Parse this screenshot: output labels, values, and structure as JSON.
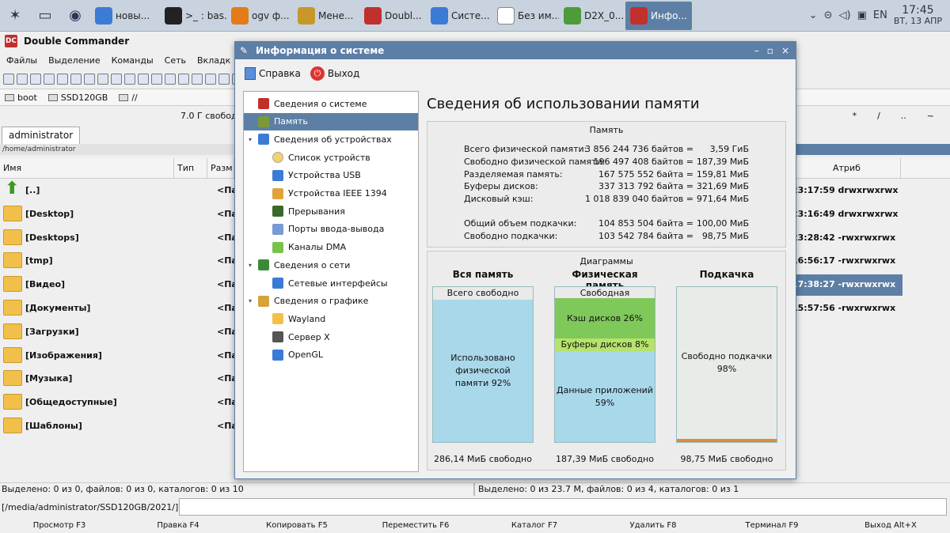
{
  "taskbar": {
    "tasks": [
      {
        "label": "новы...",
        "icon": "bird-icon",
        "color": "#3b7bd6"
      },
      {
        "label": ">_ : bas...",
        "icon": "terminal-icon",
        "color": "#222222"
      },
      {
        "label": "ogv ф...",
        "icon": "firefox-icon",
        "color": "#e37b19"
      },
      {
        "label": "Мене...",
        "icon": "package-icon",
        "color": "#c7972a"
      },
      {
        "label": "Doubl...",
        "icon": "dc-icon",
        "color": "#c0302c"
      },
      {
        "label": "Систе...",
        "icon": "monitor-icon",
        "color": "#3b7bd6"
      },
      {
        "label": "Без им...",
        "icon": "document-icon",
        "color": "#ffffff"
      },
      {
        "label": "D2X_0...",
        "icon": "image-icon",
        "color": "#4d9b3a"
      },
      {
        "label": "Инфо...",
        "icon": "star-icon",
        "color": "#c0302c"
      }
    ],
    "lang": "EN",
    "time": "17:45",
    "date": "ВТ, 13 АПР"
  },
  "dc": {
    "title": "Double Commander",
    "menu": [
      "Файлы",
      "Выделение",
      "Команды",
      "Сеть",
      "Вкладк"
    ],
    "drives": [
      "boot",
      "SSD120GB",
      "//"
    ],
    "free_left": "7.0 Г свобод",
    "right_sym": [
      "*",
      "/",
      "..",
      "~"
    ],
    "tab": "administrator",
    "path": "/home/administrator",
    "columns": {
      "name": "Имя",
      "type": "Тип",
      "size": "Разм",
      "attr": "Атриб"
    },
    "files": [
      {
        "name": "[..]",
        "size": "<Па",
        "date": "23:17:59 drwxrwxrwx",
        "up": true
      },
      {
        "name": "[Desktop]",
        "size": "<Па",
        "date": "23:16:49 drwxrwxrwx"
      },
      {
        "name": "[Desktops]",
        "size": "<Па",
        "date": "23:28:42 -rwxrwxrwx"
      },
      {
        "name": "[tmp]",
        "size": "<Па",
        "date": "16:56:17 -rwxrwxrwx"
      },
      {
        "name": "[Видео]",
        "size": "<Па",
        "date": "17:38:27 -rwxrwxrwx",
        "sel": true
      },
      {
        "name": "[Документы]",
        "size": "<Па",
        "date": "15:57:56 -rwxrwxrwx"
      },
      {
        "name": "[Загрузки]",
        "size": "<Па",
        "date": ""
      },
      {
        "name": "[Изображения]",
        "size": "<Па",
        "date": ""
      },
      {
        "name": "[Музыка]",
        "size": "<Па",
        "date": ""
      },
      {
        "name": "[Общедоступные]",
        "size": "<Па",
        "date": ""
      },
      {
        "name": "[Шаблоны]",
        "size": "<Па",
        "date": ""
      }
    ],
    "status_left": "Выделено: 0 из 0, файлов: 0 из 0, каталогов: 0 из 10",
    "status_right": "Выделено: 0 из 23.7 M, файлов: 0 из 4, каталогов: 0 из 1",
    "prompt": "[/media/administrator/SSD120GB/2021/]$:",
    "fkeys": [
      "Просмотр F3",
      "Правка F4",
      "Копировать F5",
      "Переместить F6",
      "Каталог F7",
      "Удалить F8",
      "Терминал F9",
      "Выход Alt+X"
    ]
  },
  "dialog": {
    "title": "Информация о системе",
    "help": "Справка",
    "exit": "Выход",
    "tree": [
      {
        "label": "Сведения о системе",
        "level": 0,
        "exp": "",
        "icon": "star-icon",
        "color": "#c0302c"
      },
      {
        "label": "Память",
        "level": 0,
        "exp": "",
        "icon": "memory-icon",
        "color": "#7a9a3a",
        "sel": true
      },
      {
        "label": "Сведения об устройствах",
        "level": 0,
        "exp": "▾",
        "icon": "devices-icon",
        "color": "#3b7bd6"
      },
      {
        "label": "Список устройств",
        "level": 1,
        "exp": "",
        "icon": "list-icon",
        "color": "#f2d170"
      },
      {
        "label": "Устройства USB",
        "level": 1,
        "exp": "",
        "icon": "usb-icon",
        "color": "#3b7bd6"
      },
      {
        "label": "Устройства IEEE 1394",
        "level": 1,
        "exp": "",
        "icon": "firewire-icon",
        "color": "#e0a33a"
      },
      {
        "label": "Прерывания",
        "level": 1,
        "exp": "",
        "icon": "chip-icon",
        "color": "#3a6a2a"
      },
      {
        "label": "Порты ввода-вывода",
        "level": 1,
        "exp": "",
        "icon": "port-icon",
        "color": "#7a9ad6"
      },
      {
        "label": "Каналы DMA",
        "level": 1,
        "exp": "",
        "icon": "dma-icon",
        "color": "#7ac24a"
      },
      {
        "label": "Сведения о сети",
        "level": 0,
        "exp": "▾",
        "icon": "network-icon",
        "color": "#3a8a3a"
      },
      {
        "label": "Сетевые интерфейсы",
        "level": 1,
        "exp": "",
        "icon": "interface-icon",
        "color": "#3b7bd6"
      },
      {
        "label": "Сведения о графике",
        "level": 0,
        "exp": "▾",
        "icon": "graphics-icon",
        "color": "#d6a33a"
      },
      {
        "label": "Wayland",
        "level": 1,
        "exp": "",
        "icon": "wayland-icon",
        "color": "#f2c04a"
      },
      {
        "label": "Сервер X",
        "level": 1,
        "exp": "",
        "icon": "x-icon",
        "color": "#555555"
      },
      {
        "label": "OpenGL",
        "level": 1,
        "exp": "",
        "icon": "opengl-icon",
        "color": "#3b7bd6"
      }
    ],
    "content_title": "Сведения об использовании памяти",
    "memory_title": "Память",
    "memory": [
      {
        "label": "Всего физической памяти:",
        "value": "3 856 244 736 байтов =",
        "human": "3,59 ГиБ"
      },
      {
        "label": "Свободно физической памяти:",
        "value": "196 497 408 байтов =",
        "human": "187,39 МиБ"
      },
      {
        "label": "Разделяемая память:",
        "value": "167 575 552 байта =",
        "human": "159,81 МиБ"
      },
      {
        "label": "Буферы дисков:",
        "value": "337 313 792 байта =",
        "human": "321,69 МиБ"
      },
      {
        "label": "Дисковый кэш:",
        "value": "1 018 839 040 байтов =",
        "human": "971,64 МиБ"
      }
    ],
    "swap": [
      {
        "label": "Общий объем подкачки:",
        "value": "104 853 504 байта =",
        "human": "100,00 МиБ"
      },
      {
        "label": "Свободно подкачки:",
        "value": "103 542 784 байта =",
        "human": "98,75 МиБ"
      }
    ],
    "diagrams_title": "Диаграммы",
    "diagrams": [
      {
        "title": "Вся память",
        "footer": "286,14 МиБ свободно",
        "segments": [
          {
            "label": "Всего свободно",
            "fraction": 0.08,
            "color": "#eaeaea"
          },
          {
            "label": "Использовано физической памяти 92%",
            "fraction": 0.92,
            "color": "#a8d8ea"
          }
        ]
      },
      {
        "title": "Физическая память",
        "footer": "187,39 МиБ свободно",
        "segments": [
          {
            "label": "Свободная физическая",
            "fraction": 0.07,
            "color": "#eaeaea"
          },
          {
            "label": "Кэш дисков 26%",
            "fraction": 0.26,
            "color": "#7fc85a"
          },
          {
            "label": "Буферы дисков 8%",
            "fraction": 0.08,
            "color": "#b6e36a"
          },
          {
            "label": "Данные приложений 59%",
            "fraction": 0.59,
            "color": "#a8d8ea"
          }
        ]
      },
      {
        "title": "Подкачка",
        "footer": "98,75 МиБ свободно",
        "segments": [
          {
            "label": "Свободно подкачки 98%",
            "fraction": 0.98,
            "color": "#e8ece8"
          },
          {
            "label": "",
            "fraction": 0.02,
            "color": "#e08a3a"
          }
        ]
      }
    ]
  }
}
